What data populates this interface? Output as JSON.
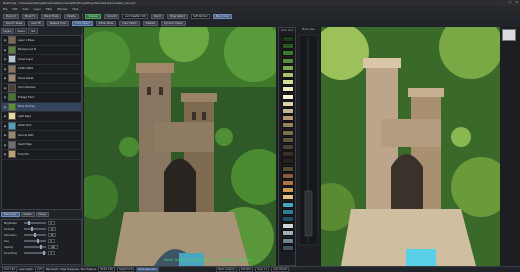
{
  "window": {
    "title": "PixelForge - C:\\Users\\pixelforge\\OneDrive\\Documents\\PixelForge\\Projects\\Castle Ruins\\castle_ruins.pxf",
    "controls": [
      "–",
      "□",
      "✕"
    ]
  },
  "menu": [
    "File",
    "Edit",
    "View",
    "Layer",
    "Filter",
    "Window",
    "Help"
  ],
  "toolbar1": {
    "items": [
      "Pixel Art",
      "Brush Fx",
      "Blend Mode",
      "Palette",
      "Sharpen",
      "Smooth",
      "Pencil",
      "Edge Detect"
    ],
    "size_value": "Lock Palette 3.00",
    "mode_label": "Soft Normal",
    "accent_label": "Blend Over"
  },
  "toolbar2": {
    "items": [
      "Pixel Fx Rules",
      "Auto Fill",
      "Replace Color",
      "Color Select",
      "Dither Mode",
      "Color Match",
      "Pixelate",
      "Dynamic Depth"
    ]
  },
  "panel": {
    "tabs": [
      "Layers",
      "Masks",
      "Hist"
    ],
    "layers": [
      {
        "name": "Layer 1 Base",
        "color": "#7a6a55",
        "selected": false
      },
      {
        "name": "Background Sky",
        "color": "#5d7f3e",
        "selected": false
      },
      {
        "name": "Cloud Layer",
        "color": "#b8c9d8",
        "selected": false
      },
      {
        "name": "Castle Walls",
        "color": "#8a7560",
        "selected": false
      },
      {
        "name": "Stone Detail",
        "color": "#a08868",
        "selected": false
      },
      {
        "name": "Arch Shadows",
        "color": "#4a3f35",
        "selected": false
      },
      {
        "name": "Foliage Front",
        "color": "#3f7a2c",
        "selected": false
      },
      {
        "name": "Moss Overlay",
        "color": "#5a8f3a",
        "selected": true
      },
      {
        "name": "Light Rays",
        "color": "#e8dc9a",
        "selected": false
      },
      {
        "name": "Water Pool",
        "color": "#4aa5c0",
        "selected": false
      },
      {
        "name": "Ground Path",
        "color": "#9a8770",
        "selected": false
      },
      {
        "name": "Depth Map",
        "color": "#6f6f6f",
        "selected": false
      },
      {
        "name": "Final Mix",
        "color": "#c0a070",
        "selected": false
      }
    ],
    "buttons": [
      "New Layer",
      "Delete",
      "Merge"
    ],
    "props": [
      {
        "label": "Brightness",
        "value": "0"
      },
      {
        "label": "Contrast",
        "value": "12"
      },
      {
        "label": "Saturation",
        "value": "45"
      },
      {
        "label": "Hue",
        "value": "0"
      },
      {
        "label": "Opacity",
        "value": "100"
      },
      {
        "label": "Smoothing",
        "value": "3"
      }
    ]
  },
  "palettes": {
    "left_title": "Color Lock",
    "right_title": "Mesh View",
    "swatches": [
      "#1d3b1b",
      "#2c5a23",
      "#3f7a2c",
      "#5a8f3a",
      "#7ea850",
      "#a7c46b",
      "#d4dd95",
      "#efe9be",
      "#f7f2da",
      "#e0d2b0",
      "#c8b58d",
      "#b09a74",
      "#978160",
      "#7d6a50",
      "#655543",
      "#4d4137",
      "#3a312b",
      "#2a2420",
      "#5a4a3a",
      "#8a5a3a",
      "#b07545",
      "#d29a5a",
      "#e8c080",
      "#4aa5c0",
      "#2f7d96",
      "#1d5566",
      "#cfd8dd",
      "#9fb0bd",
      "#6f8596",
      "#3f5566"
    ]
  },
  "mesh_info": {
    "height_label": "Mesh Height: 2.56(2.56mm)",
    "tri_label": "Triangles: 3802200"
  },
  "status": {
    "items": [
      "Grid 1.00",
      "Layer Depth",
      "0.25",
      "Max Depth",
      "Edge Sharpness",
      "Blur Distance",
      "Width 0.00",
      "Height 0.00",
      "Mesh Resolution"
    ],
    "right_buttons": [
      "Mesh Analyzer",
      "Snap 1:1",
      "Auto Detect"
    ],
    "zoom": "100.00%"
  },
  "colors": {
    "accent": "#3f7fd6",
    "highlight": "#3fdc5a"
  }
}
